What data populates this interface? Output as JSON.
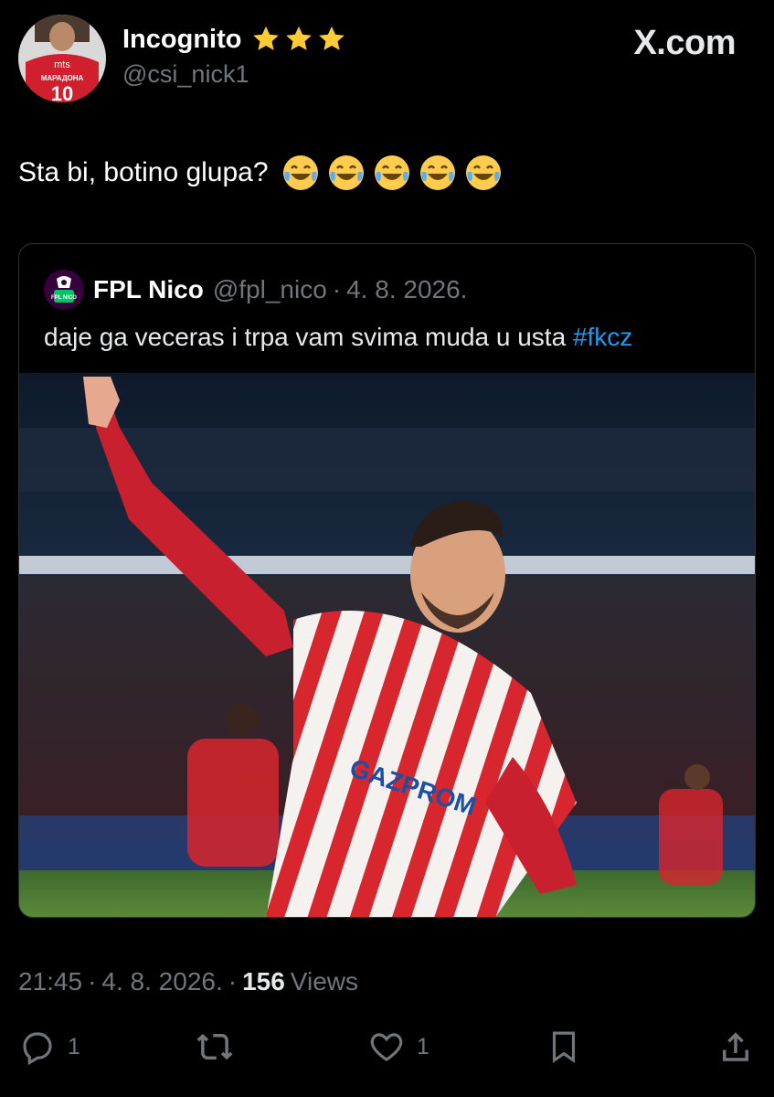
{
  "author": {
    "display_name": "Incognito",
    "handle": "@csi_nick1",
    "avatar_text_top": "mts",
    "avatar_text_mid": "МАРАДОНА",
    "avatar_number": "10"
  },
  "brand": "X.com",
  "tweet": {
    "text": "Sta bi, botino glupa?",
    "emoji": [
      "😂",
      "😂",
      "😂",
      "😂",
      "😂"
    ]
  },
  "quoted": {
    "display_name": "FPL Nico",
    "handle": "@fpl_nico",
    "separator": "·",
    "date": "4. 8. 2026.",
    "text": "daje ga veceras i trpa vam svima muda u usta",
    "hashtag": "#fkcz",
    "avatar_text": "FPL NICO",
    "photo_sponsor": "GAZPROM"
  },
  "meta": {
    "time": "21:45",
    "sep": "·",
    "date": "4. 8. 2026.",
    "sep2": "·",
    "views_count": "156",
    "views_label": "Views"
  },
  "actions": {
    "replies": "1",
    "reposts": "",
    "likes": "1"
  },
  "colors": {
    "accent": "#1d9bf0",
    "muted": "#71767b",
    "star": "#ffcc33"
  }
}
